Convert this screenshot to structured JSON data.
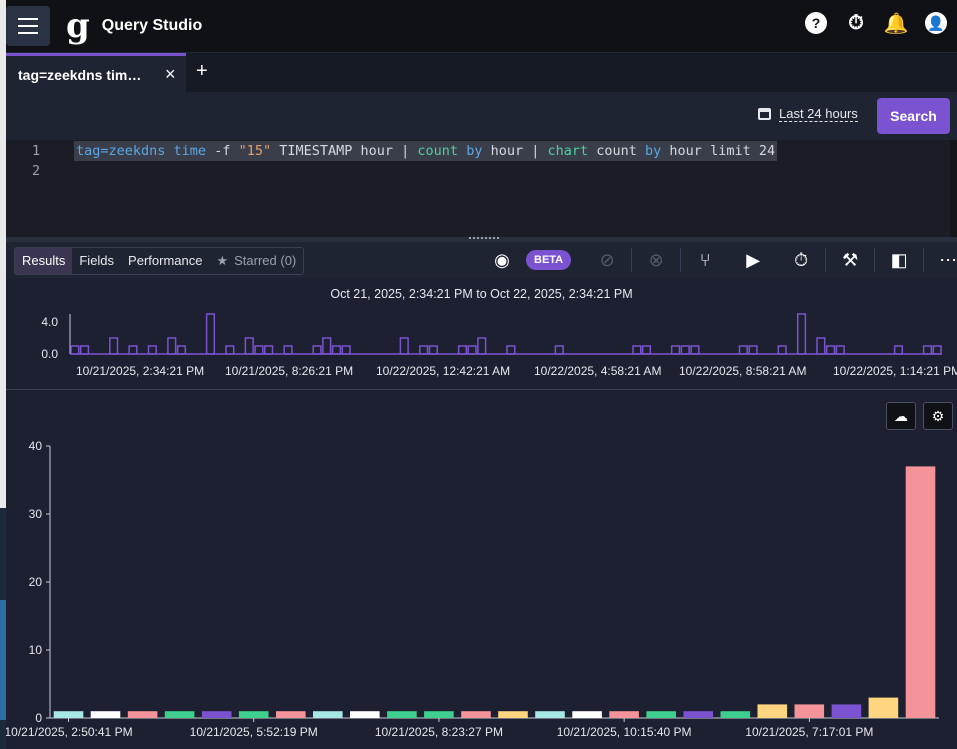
{
  "app": {
    "title": "Query Studio",
    "logo_glyph": "g"
  },
  "header_icons": [
    "help-icon",
    "timer-icon",
    "notifications-icon",
    "account-icon"
  ],
  "tabs": [
    {
      "label": "tag=zeekdns tim…",
      "close": "×"
    }
  ],
  "add_tab": "+",
  "time_range": "Last 24 hours",
  "search_label": "Search",
  "editor": {
    "line_numbers": [
      "1",
      "2"
    ],
    "query": "tag=zeekdns time -f \"15\" TIMESTAMP hour | count by hour | chart count by hour limit 24"
  },
  "view_tabs": {
    "results": "Results",
    "fields": "Fields",
    "performance": "Performance",
    "starred": "Starred (0)"
  },
  "beta_label": "BETA",
  "colors": {
    "accent": "#7b52d0",
    "series": [
      "#a8e8e4",
      "#ffffff",
      "#f49399",
      "#3ecf8e",
      "#7b52d0",
      "#3ecf8e",
      "#f49399",
      "#a8e8e4",
      "#ffffff",
      "#3ecf8e",
      "#3ecf8e",
      "#f49399",
      "#ffd580",
      "#a8e8e4",
      "#ffffff",
      "#f49399",
      "#3ecf8e",
      "#7b52d0",
      "#3ecf8e",
      "#ffd580",
      "#f49399",
      "#7b52d0",
      "#ffd580",
      "#f49399"
    ]
  },
  "overview": {
    "title": "Oct 21, 2025, 2:34:21 PM to Oct 22, 2025, 2:34:21 PM",
    "y_ticks": [
      "4.0",
      "0.0"
    ],
    "x_ticks": [
      "10/21/2025, 2:34:21 PM",
      "10/21/2025, 8:26:21 PM",
      "10/22/2025, 12:42:21 AM",
      "10/22/2025, 4:58:21 AM",
      "10/22/2025, 8:58:21 AM",
      "10/22/2025, 1:14:21 PM"
    ],
    "ylim": [
      0,
      5
    ],
    "bins": [
      1,
      1,
      0,
      0,
      2,
      0,
      1,
      0,
      1,
      0,
      2,
      1,
      0,
      0,
      5,
      0,
      1,
      0,
      2,
      1,
      1,
      0,
      1,
      0,
      0,
      1,
      2,
      1,
      1,
      0,
      0,
      0,
      0,
      0,
      2,
      0,
      1,
      1,
      0,
      0,
      1,
      1,
      2,
      0,
      0,
      1,
      0,
      0,
      0,
      0,
      1,
      0,
      0,
      0,
      0,
      0,
      0,
      0,
      1,
      1,
      0,
      0,
      1,
      1,
      1,
      0,
      0,
      0,
      0,
      1,
      1,
      0,
      0,
      1,
      0,
      5,
      0,
      2,
      1,
      1,
      0,
      0,
      0,
      0,
      0,
      1,
      0,
      0,
      1,
      1
    ]
  },
  "chart_data": {
    "type": "bar",
    "categories": [
      "10/21/2025, 2:50:41 PM",
      "",
      "",
      "",
      "",
      "10/21/2025, 5:52:19 PM",
      "",
      "",
      "",
      "",
      "10/21/2025, 8:23:27 PM",
      "",
      "",
      "",
      "",
      "10/21/2025, 10:15:40 PM",
      "",
      "",
      "",
      "",
      "10/21/2025, 7:17:01 PM",
      "",
      "",
      ""
    ],
    "values": [
      1,
      1,
      1,
      1,
      1,
      1,
      1,
      1,
      1,
      1,
      1,
      1,
      1,
      1,
      1,
      1,
      1,
      1,
      1,
      2,
      2,
      2,
      3,
      37
    ],
    "y_ticks": [
      0,
      10,
      20,
      30,
      40
    ],
    "ylim": [
      0,
      40
    ],
    "grid": false
  }
}
